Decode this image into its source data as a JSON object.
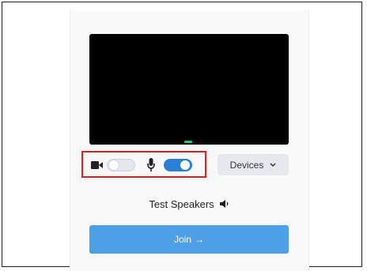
{
  "video_preview": {
    "indicator_color": "#19c37d"
  },
  "controls": {
    "camera": {
      "icon": "video-camera-icon",
      "enabled": false
    },
    "microphone": {
      "icon": "microphone-icon",
      "enabled": true
    },
    "highlight_color": "#e02020"
  },
  "devices_button": {
    "label": "Devices",
    "icon": "chevron-down-icon"
  },
  "test_speakers": {
    "label": "Test Speakers",
    "icon": "speaker-icon"
  },
  "join_button": {
    "label": "Join",
    "arrow": "→",
    "color": "#4d9fe6"
  },
  "colors": {
    "toggle_on": "#2a7fd6",
    "toggle_off": "#e4e7ee"
  }
}
